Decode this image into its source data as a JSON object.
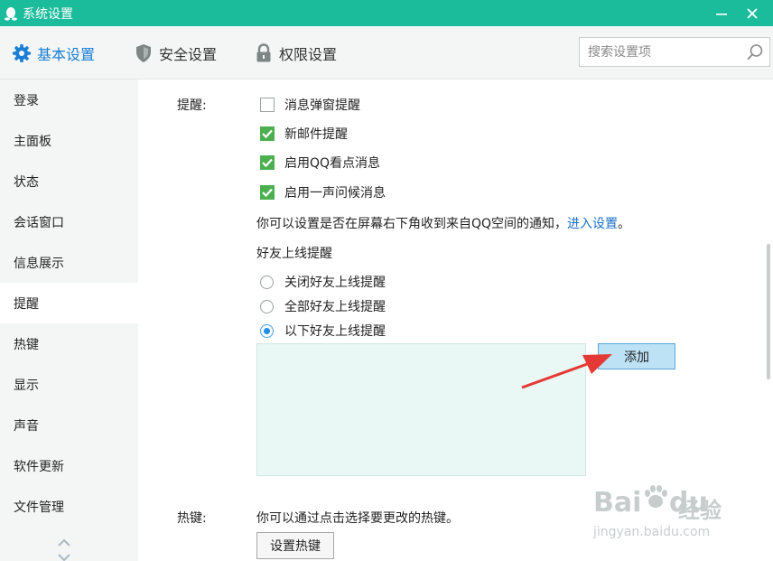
{
  "window": {
    "title": "系统设置",
    "accent_color": "#1bbc9b",
    "minimize_icon": "minimize-icon",
    "close_icon": "close-icon"
  },
  "tabs": [
    {
      "label": "基本设置",
      "icon": "gear-icon",
      "active": true
    },
    {
      "label": "安全设置",
      "icon": "shield-icon",
      "active": false
    },
    {
      "label": "权限设置",
      "icon": "lock-icon",
      "active": false
    }
  ],
  "search": {
    "placeholder": "搜索设置项",
    "icon": "search-icon"
  },
  "sidebar": {
    "items": [
      {
        "label": "登录"
      },
      {
        "label": "主面板"
      },
      {
        "label": "状态"
      },
      {
        "label": "会话窗口"
      },
      {
        "label": "信息展示"
      },
      {
        "label": "提醒",
        "active": true
      },
      {
        "label": "热键"
      },
      {
        "label": "显示"
      },
      {
        "label": "声音"
      },
      {
        "label": "软件更新"
      },
      {
        "label": "文件管理"
      }
    ]
  },
  "reminder": {
    "section_label": "提醒:",
    "checkboxes": [
      {
        "label": "消息弹窗提醒",
        "checked": false
      },
      {
        "label": "新邮件提醒",
        "checked": true
      },
      {
        "label": "启用QQ看点消息",
        "checked": true
      },
      {
        "label": "启用一声问候消息",
        "checked": true
      }
    ],
    "qzone_note": "你可以设置是否在屏幕右下角收到来自QQ空间的通知，",
    "qzone_link": "进入设置",
    "qzone_end": "。",
    "friend_online_title": "好友上线提醒",
    "radios": [
      {
        "label": "关闭好友上线提醒",
        "selected": false
      },
      {
        "label": "全部好友上线提醒",
        "selected": false
      },
      {
        "label": "以下好友上线提醒",
        "selected": true
      }
    ],
    "add_button": "添加"
  },
  "hotkey": {
    "section_label": "热键:",
    "description": "你可以通过点击选择要更改的热键。",
    "button": "设置热键"
  },
  "watermark": {
    "brand_a": "Bai",
    "brand_b": "du",
    "brand_cn": "经验",
    "url": "jingyan.baidu.com"
  }
}
